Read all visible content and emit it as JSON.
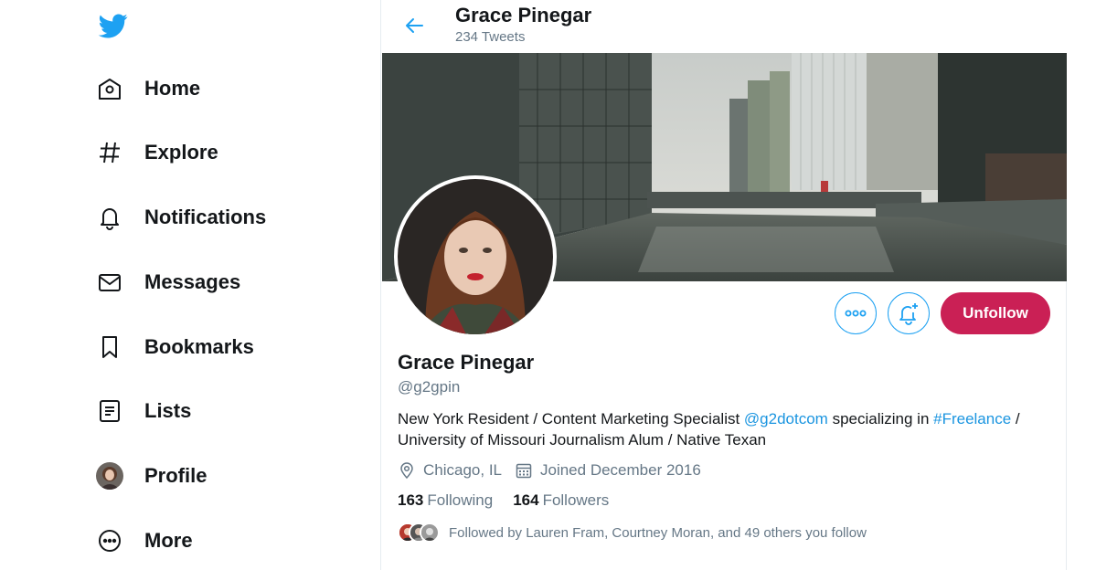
{
  "sidebar": {
    "logo_icon": "twitter-bird-icon",
    "items": [
      {
        "label": "Home",
        "icon": "home-icon"
      },
      {
        "label": "Explore",
        "icon": "hashtag-icon"
      },
      {
        "label": "Notifications",
        "icon": "bell-icon"
      },
      {
        "label": "Messages",
        "icon": "envelope-icon"
      },
      {
        "label": "Bookmarks",
        "icon": "bookmark-icon"
      },
      {
        "label": "Lists",
        "icon": "list-icon"
      },
      {
        "label": "Profile",
        "icon": "avatar"
      },
      {
        "label": "More",
        "icon": "more-circle-icon"
      }
    ]
  },
  "header": {
    "name": "Grace Pinegar",
    "tweet_count": "234 Tweets"
  },
  "profile": {
    "name": "Grace Pinegar",
    "handle": "@g2gpin",
    "bio": {
      "part1": "New York Resident / Content Marketing Specialist ",
      "mention": "@g2dotcom",
      "part2": " specializing in ",
      "hashtag": "#Freelance",
      "part3": " / University of Missouri Journalism Alum / Native Texan"
    },
    "location": "Chicago, IL",
    "joined": "Joined December 2016",
    "following_count": "163",
    "following_label": "Following",
    "followers_count": "164",
    "followers_label": "Followers",
    "followed_by": "Followed by Lauren Fram, Courtney Moran, and 49 others you follow"
  },
  "actions": {
    "more_icon": "more-horizontal-icon",
    "notify_icon": "bell-plus-icon",
    "unfollow_label": "Unfollow"
  },
  "colors": {
    "accent": "#1da1f2",
    "link": "#1b95e0",
    "unfollow": "#ca2055",
    "muted": "#657786"
  }
}
